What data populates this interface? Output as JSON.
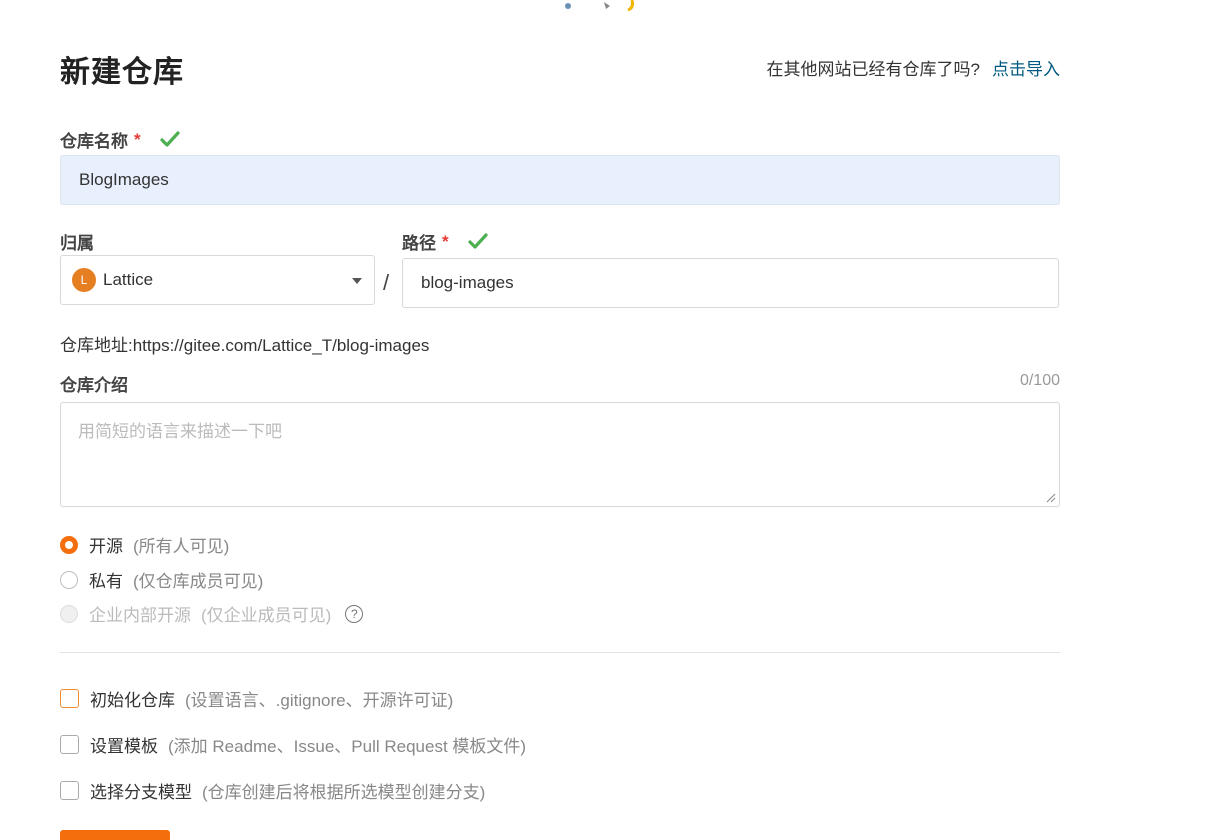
{
  "header": {
    "title": "新建仓库",
    "import_prompt": "在其他网站已经有仓库了吗?",
    "import_link": "点击导入"
  },
  "repo_name": {
    "label": "仓库名称",
    "required_mark": "*",
    "value": "BlogImages"
  },
  "owner": {
    "label": "归属",
    "avatar_letter": "L",
    "value": "Lattice"
  },
  "separator": "/",
  "path": {
    "label": "路径",
    "required_mark": "*",
    "value": "blog-images"
  },
  "address": {
    "text": "仓库地址:https://gitee.com/Lattice_T/blog-images"
  },
  "description": {
    "label": "仓库介绍",
    "counter": "0/100",
    "placeholder": "用简短的语言来描述一下吧"
  },
  "visibility": {
    "options": [
      {
        "label": "开源",
        "hint": "(所有人可见)",
        "selected": true,
        "disabled": false
      },
      {
        "label": "私有",
        "hint": "(仅仓库成员可见)",
        "selected": false,
        "disabled": false
      },
      {
        "label": "企业内部开源",
        "hint": "(仅企业成员可见)",
        "selected": false,
        "disabled": true
      }
    ],
    "help_glyph": "?"
  },
  "options": [
    {
      "label": "初始化仓库",
      "hint": "(设置语言、.gitignore、开源许可证)",
      "checked": false
    },
    {
      "label": "设置模板",
      "hint": "(添加 Readme、Issue、Pull Request 模板文件)",
      "checked": false
    },
    {
      "label": "选择分支模型",
      "hint": "(仓库创建后将根据所选模型创建分支)",
      "checked": false
    }
  ],
  "colors": {
    "accent": "#f46e0d",
    "link": "#005980",
    "valid": "#4caf50",
    "required": "#e53935",
    "filled_bg": "#e8f0fe"
  }
}
